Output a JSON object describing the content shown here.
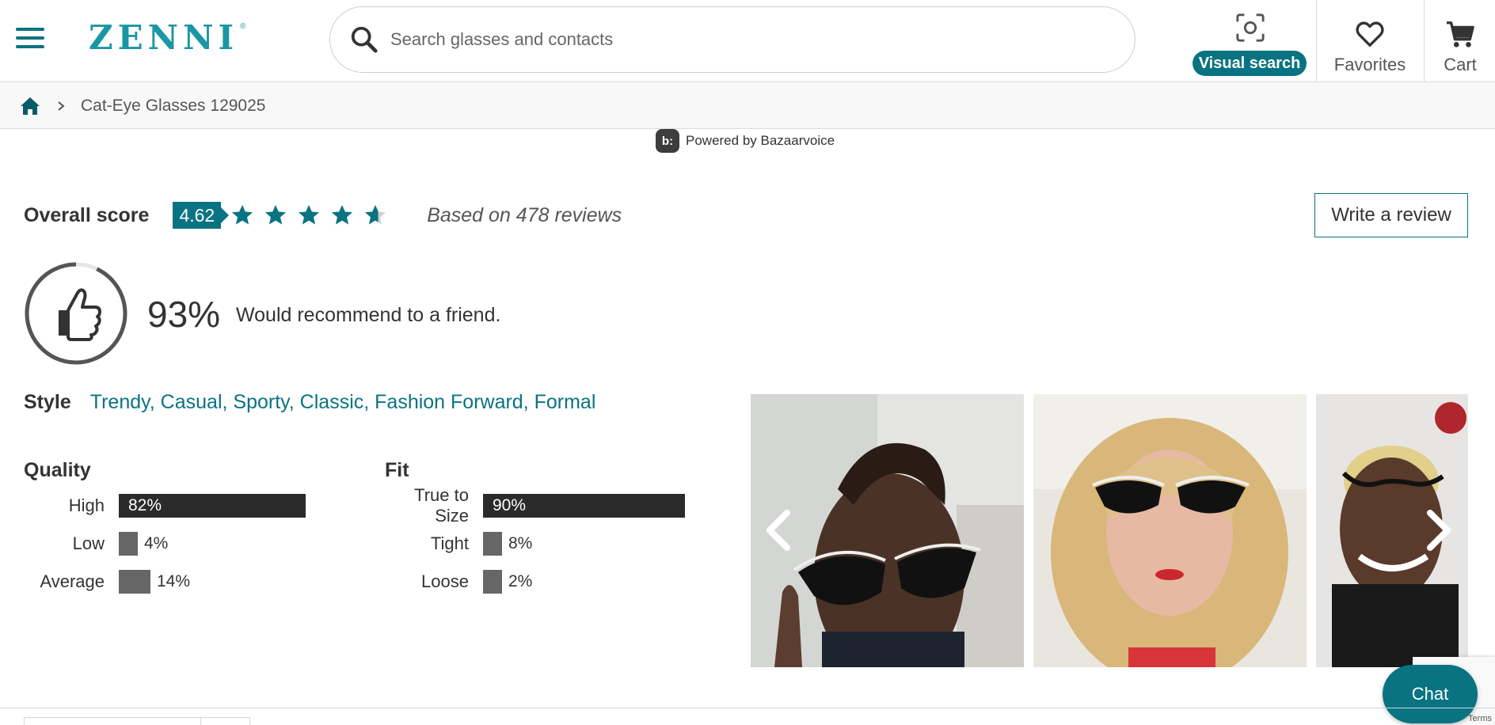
{
  "header": {
    "logo": "ZENNI",
    "logo_mark": "®",
    "search_placeholder": "Search glasses and contacts",
    "visual_search_label": "Visual search",
    "favorites_label": "Favorites",
    "cart_label": "Cart"
  },
  "breadcrumb": {
    "items": [
      "Cat-Eye Glasses 129025"
    ]
  },
  "powered_by": {
    "badge": "b:",
    "text": "Powered by Bazaarvoice"
  },
  "summary": {
    "overall_label": "Overall score",
    "score": "4.62",
    "rating_value": 4.62,
    "rating_max": 5,
    "based_on": "Based on 478 reviews",
    "write_review": "Write a review",
    "recommend_pct": "93%",
    "recommend_text": "Would recommend to a friend."
  },
  "style": {
    "label": "Style",
    "values": "Trendy, Casual, Sporty, Classic, Fashion Forward, Formal"
  },
  "quality": {
    "title": "Quality",
    "rows": [
      {
        "label": "High",
        "pct": "82%",
        "value": 82
      },
      {
        "label": "Low",
        "pct": "4%",
        "value": 4
      },
      {
        "label": "Average",
        "pct": "14%",
        "value": 14
      }
    ]
  },
  "fit": {
    "title": "Fit",
    "rows": [
      {
        "label": "True to Size",
        "pct": "90%",
        "value": 90
      },
      {
        "label": "Tight",
        "pct": "8%",
        "value": 8
      },
      {
        "label": "Loose",
        "pct": "2%",
        "value": 2
      }
    ]
  },
  "chat_label": "Chat",
  "recaptcha_terms": "Terms",
  "colors": {
    "brand": "#0a7382",
    "logo": "#1a96a5",
    "bar_dark": "#2b2b2b",
    "bar_small": "#666666"
  }
}
